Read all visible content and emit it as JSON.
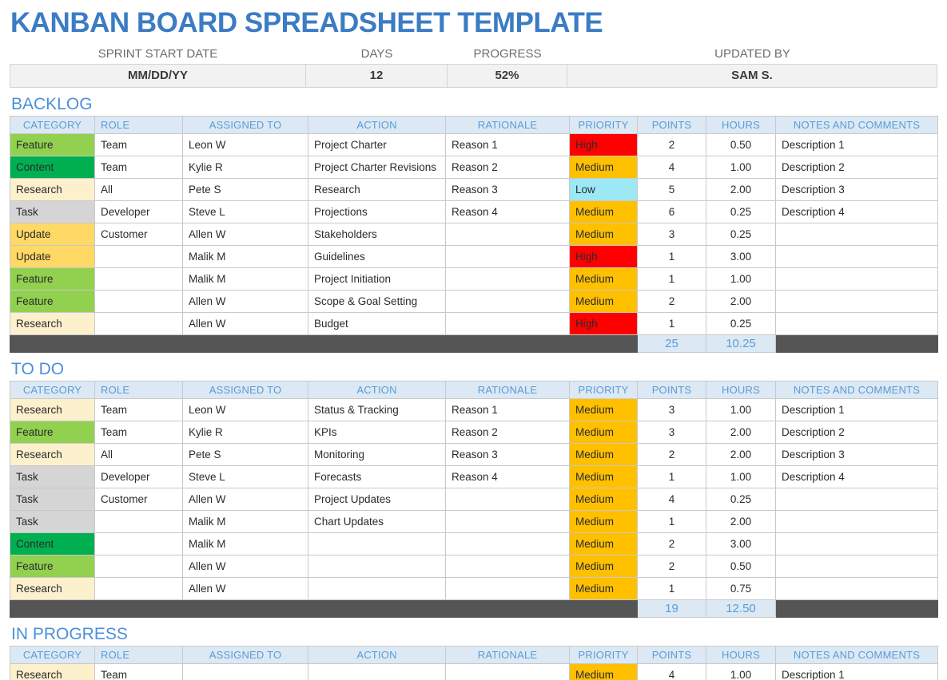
{
  "title": "KANBAN BOARD SPREADSHEET TEMPLATE",
  "colors": {
    "title_blue": "#3B7CC4",
    "section_blue": "#4A90D9",
    "header_fill": "#DCE9F5",
    "totals_bar": "#555555",
    "cat_feature": "#92D050",
    "cat_content": "#00B050",
    "cat_research": "#FDF0CD",
    "cat_task": "#D5D5D5",
    "cat_update": "#FFD966",
    "pri_high": "#FF0000",
    "pri_medium": "#FFC000",
    "pri_low": "#9CE8F5"
  },
  "summary": {
    "labels": {
      "sprint_start_date": "SPRINT START DATE",
      "days": "DAYS",
      "progress": "PROGRESS",
      "updated_by": "UPDATED BY"
    },
    "values": {
      "sprint_start_date": "MM/DD/YY",
      "days": "12",
      "progress": "52%",
      "updated_by": "SAM S."
    }
  },
  "columns": {
    "category": "CATEGORY",
    "role": "ROLE",
    "assigned_to": "ASSIGNED TO",
    "action": "ACTION",
    "rationale": "RATIONALE",
    "priority": "PRIORITY",
    "points": "POINTS",
    "hours": "HOURS",
    "notes": "NOTES AND COMMENTS"
  },
  "sections": [
    {
      "name": "BACKLOG",
      "rows": [
        {
          "category": "Feature",
          "cat_class": "cat-feature",
          "role": "Team",
          "assigned_to": "Leon W",
          "action": "Project Charter",
          "rationale": "Reason 1",
          "priority": "High",
          "pri_class": "pri-high",
          "points": "2",
          "hours": "0.50",
          "notes": "Description 1"
        },
        {
          "category": "Content",
          "cat_class": "cat-content",
          "role": "Team",
          "assigned_to": "Kylie R",
          "action": "Project Charter Revisions",
          "rationale": "Reason 2",
          "priority": "Medium",
          "pri_class": "pri-medium",
          "points": "4",
          "hours": "1.00",
          "notes": "Description 2"
        },
        {
          "category": "Research",
          "cat_class": "cat-research",
          "role": "All",
          "assigned_to": "Pete S",
          "action": "Research",
          "rationale": "Reason 3",
          "priority": "Low",
          "pri_class": "pri-low",
          "points": "5",
          "hours": "2.00",
          "notes": "Description 3"
        },
        {
          "category": "Task",
          "cat_class": "cat-task",
          "role": "Developer",
          "assigned_to": "Steve L",
          "action": "Projections",
          "rationale": "Reason 4",
          "priority": "Medium",
          "pri_class": "pri-medium",
          "points": "6",
          "hours": "0.25",
          "notes": "Description 4"
        },
        {
          "category": "Update",
          "cat_class": "cat-update",
          "role": "Customer",
          "assigned_to": "Allen W",
          "action": "Stakeholders",
          "rationale": "",
          "priority": "Medium",
          "pri_class": "pri-medium",
          "points": "3",
          "hours": "0.25",
          "notes": ""
        },
        {
          "category": "Update",
          "cat_class": "cat-update",
          "role": "",
          "assigned_to": "Malik M",
          "action": "Guidelines",
          "rationale": "",
          "priority": "High",
          "pri_class": "pri-high",
          "points": "1",
          "hours": "3.00",
          "notes": ""
        },
        {
          "category": "Feature",
          "cat_class": "cat-feature",
          "role": "",
          "assigned_to": "Malik M",
          "action": "Project Initiation",
          "rationale": "",
          "priority": "Medium",
          "pri_class": "pri-medium",
          "points": "1",
          "hours": "1.00",
          "notes": ""
        },
        {
          "category": "Feature",
          "cat_class": "cat-feature",
          "role": "",
          "assigned_to": "Allen W",
          "action": "Scope & Goal Setting",
          "rationale": "",
          "priority": "Medium",
          "pri_class": "pri-medium",
          "points": "2",
          "hours": "2.00",
          "notes": ""
        },
        {
          "category": "Research",
          "cat_class": "cat-research",
          "role": "",
          "assigned_to": "Allen W",
          "action": "Budget",
          "rationale": "",
          "priority": "High",
          "pri_class": "pri-high",
          "points": "1",
          "hours": "0.25",
          "notes": ""
        }
      ],
      "totals": {
        "points": "25",
        "hours": "10.25"
      }
    },
    {
      "name": "TO DO",
      "rows": [
        {
          "category": "Research",
          "cat_class": "cat-research",
          "role": "Team",
          "assigned_to": "Leon W",
          "action": "Status & Tracking",
          "rationale": "Reason 1",
          "priority": "Medium",
          "pri_class": "pri-medium",
          "points": "3",
          "hours": "1.00",
          "notes": "Description 1"
        },
        {
          "category": "Feature",
          "cat_class": "cat-feature",
          "role": "Team",
          "assigned_to": "Kylie R",
          "action": "KPIs",
          "rationale": "Reason 2",
          "priority": "Medium",
          "pri_class": "pri-medium",
          "points": "3",
          "hours": "2.00",
          "notes": "Description 2"
        },
        {
          "category": "Research",
          "cat_class": "cat-research",
          "role": "All",
          "assigned_to": "Pete S",
          "action": "Monitoring",
          "rationale": "Reason 3",
          "priority": "Medium",
          "pri_class": "pri-medium",
          "points": "2",
          "hours": "2.00",
          "notes": "Description 3"
        },
        {
          "category": "Task",
          "cat_class": "cat-task",
          "role": "Developer",
          "assigned_to": "Steve L",
          "action": "Forecasts",
          "rationale": "Reason 4",
          "priority": "Medium",
          "pri_class": "pri-medium",
          "points": "1",
          "hours": "1.00",
          "notes": "Description 4"
        },
        {
          "category": "Task",
          "cat_class": "cat-task",
          "role": "Customer",
          "assigned_to": "Allen W",
          "action": "Project Updates",
          "rationale": "",
          "priority": "Medium",
          "pri_class": "pri-medium",
          "points": "4",
          "hours": "0.25",
          "notes": ""
        },
        {
          "category": "Task",
          "cat_class": "cat-task",
          "role": "",
          "assigned_to": "Malik M",
          "action": "Chart Updates",
          "rationale": "",
          "priority": "Medium",
          "pri_class": "pri-medium",
          "points": "1",
          "hours": "2.00",
          "notes": ""
        },
        {
          "category": "Content",
          "cat_class": "cat-content",
          "role": "",
          "assigned_to": "Malik M",
          "action": "",
          "rationale": "",
          "priority": "Medium",
          "pri_class": "pri-medium",
          "points": "2",
          "hours": "3.00",
          "notes": ""
        },
        {
          "category": "Feature",
          "cat_class": "cat-feature",
          "role": "",
          "assigned_to": "Allen W",
          "action": "",
          "rationale": "",
          "priority": "Medium",
          "pri_class": "pri-medium",
          "points": "2",
          "hours": "0.50",
          "notes": ""
        },
        {
          "category": "Research",
          "cat_class": "cat-research",
          "role": "",
          "assigned_to": "Allen W",
          "action": "",
          "rationale": "",
          "priority": "Medium",
          "pri_class": "pri-medium",
          "points": "1",
          "hours": "0.75",
          "notes": ""
        }
      ],
      "totals": {
        "points": "19",
        "hours": "12.50"
      }
    },
    {
      "name": "IN PROGRESS",
      "rows": [
        {
          "category": "Research",
          "cat_class": "cat-research",
          "role": "Team",
          "assigned_to": "",
          "action": "",
          "rationale": "",
          "priority": "Medium",
          "pri_class": "pri-medium",
          "points": "4",
          "hours": "1.00",
          "notes": "Description 1"
        }
      ],
      "totals": null
    }
  ]
}
